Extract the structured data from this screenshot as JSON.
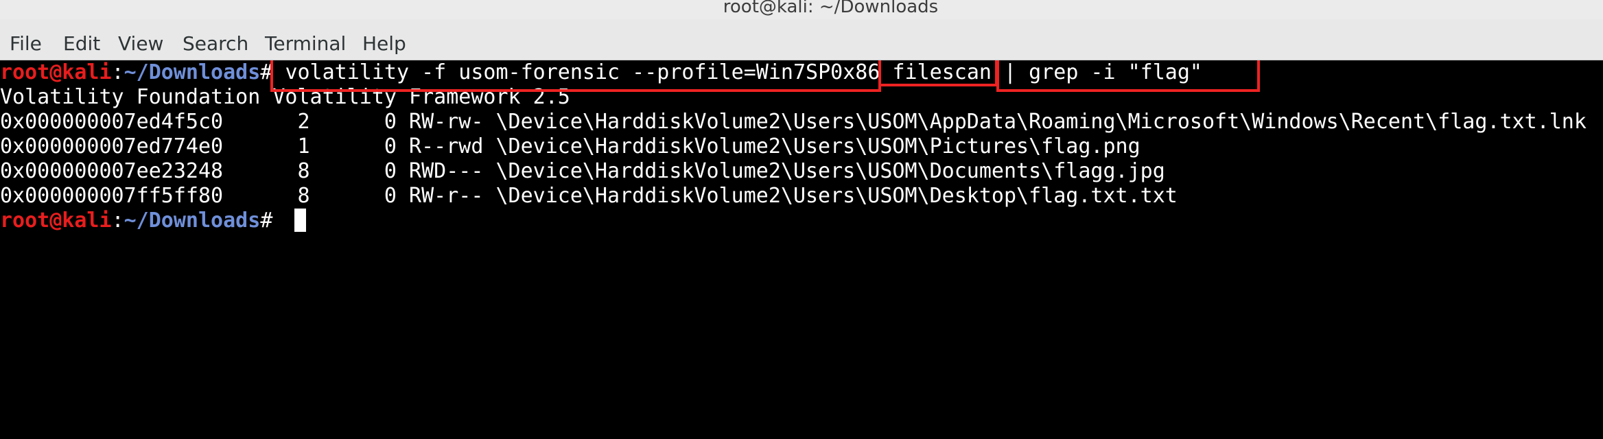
{
  "window": {
    "title": "root@kali: ~/Downloads"
  },
  "menu": {
    "items": [
      "File",
      "Edit",
      "View",
      "Search",
      "Terminal",
      "Help"
    ]
  },
  "prompt": {
    "user_host": "root@kali",
    "colon": ":",
    "path": "~/Downloads",
    "symbol": "# "
  },
  "command": "volatility -f usom-forensic --profile=Win7SP0x86 filescan | grep -i \"flag\"",
  "output": [
    "Volatility Foundation Volatility Framework 2.5",
    "0x000000007ed4f5c0      2      0 RW-rw- \\Device\\HarddiskVolume2\\Users\\USOM\\AppData\\Roaming\\Microsoft\\Windows\\Recent\\flag.txt.lnk",
    "0x000000007ed774e0      1      0 R--rwd \\Device\\HarddiskVolume2\\Users\\USOM\\Pictures\\flag.png",
    "0x000000007ee23248      8      0 RWD--- \\Device\\HarddiskVolume2\\Users\\USOM\\Documents\\flagg.jpg",
    "0x000000007ff5ff80      8      0 RW-r-- \\Device\\HarddiskVolume2\\Users\\USOM\\Desktop\\flag.txt.txt"
  ],
  "colors": {
    "prompt_user": "#e81d1d",
    "prompt_path": "#6f8fd9",
    "highlight_box": "#ee2222",
    "terminal_bg": "#000000",
    "terminal_fg": "#ffffff"
  }
}
